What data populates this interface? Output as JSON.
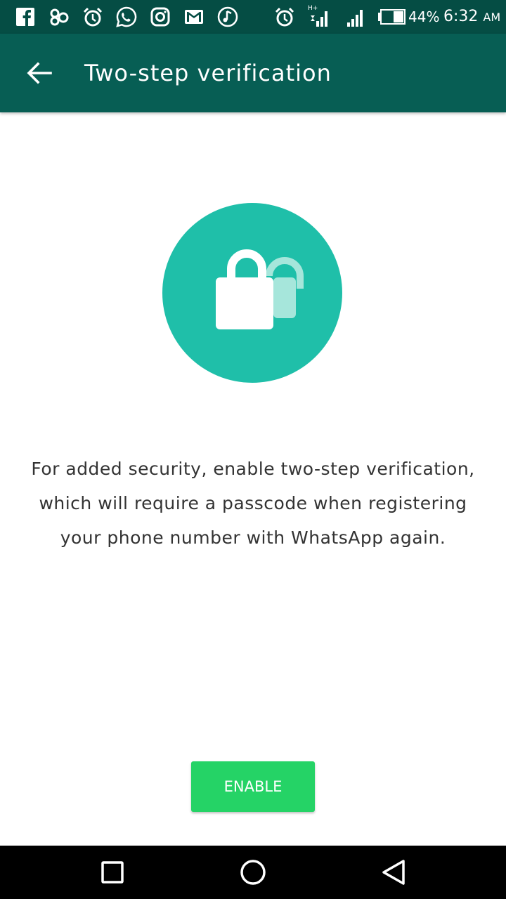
{
  "status_bar": {
    "battery_percent": "44%",
    "time": "6:32",
    "am_pm": "AM",
    "network_type": "H+",
    "notification_icons": [
      "facebook-icon",
      "app-icon",
      "alarm-icon",
      "whatsapp-icon",
      "instagram-icon",
      "gmail-icon",
      "music-icon"
    ],
    "system_icons": [
      "alarm-icon",
      "mobile-signal-icon",
      "signal-icon",
      "battery-icon"
    ]
  },
  "toolbar": {
    "back_icon": "arrow-back-icon",
    "title": "Two-step verification"
  },
  "hero": {
    "icon": "lock-icon",
    "circle_color": "#1fbfa9"
  },
  "description": {
    "line1": "For added security, enable two-step verification,",
    "line2": "which will require a passcode when registering",
    "line3": "your phone number with WhatsApp again."
  },
  "actions": {
    "enable_label": "ENABLE",
    "enable_color": "#25d366"
  },
  "nav_bar": {
    "icons": [
      "recent-apps-icon",
      "home-icon",
      "back-icon"
    ]
  },
  "colors": {
    "status_bar": "#054d44",
    "toolbar": "#075e54",
    "background": "#ffffff",
    "text": "#333333"
  }
}
